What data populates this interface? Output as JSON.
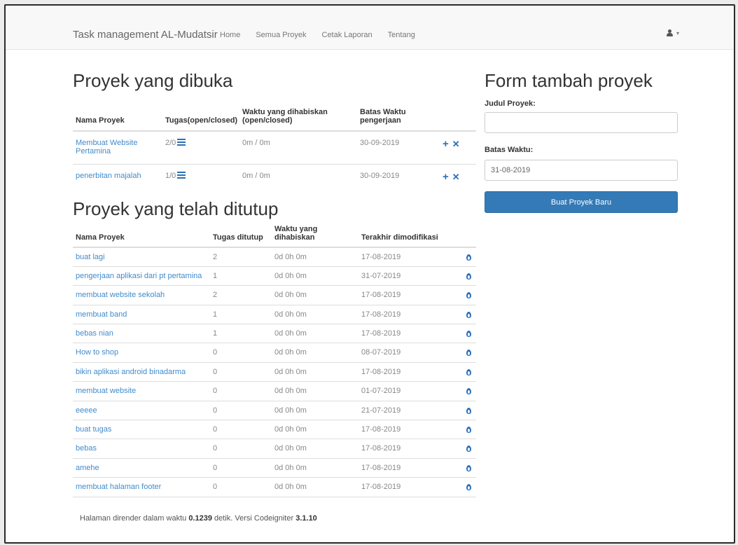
{
  "navbar": {
    "brand": "Task management AL-Mudatsir",
    "links": [
      "Home",
      "Semua Proyek",
      "Cetak Laporan",
      "Tentang"
    ]
  },
  "open_projects": {
    "title": "Proyek yang dibuka",
    "headers": {
      "name": "Nama Proyek",
      "tasks": "Tugas(open/closed)",
      "time_line1": "Waktu yang dihabiskan",
      "time_line2": "(open/closed)",
      "deadline_line1": "Batas Waktu",
      "deadline_line2": "pengerjaan"
    },
    "rows": [
      {
        "name_line1": "Membuat Website",
        "name_line2": "Pertamina",
        "tasks": "2/0",
        "time": "0m / 0m",
        "deadline": "30-09-2019"
      },
      {
        "name_line1": "penerbitan majalah",
        "name_line2": "",
        "tasks": "1/0",
        "time": "0m / 0m",
        "deadline": "30-09-2019"
      }
    ]
  },
  "closed_projects": {
    "title": "Proyek yang telah ditutup",
    "headers": {
      "name": "Nama Proyek",
      "tasks": "Tugas ditutup",
      "time": "Waktu yang dihabiskan",
      "modified": "Terakhir dimodifikasi"
    },
    "rows": [
      {
        "name": "buat lagi",
        "tasks": "2",
        "time": "0d 0h 0m",
        "modified": "17-08-2019"
      },
      {
        "name": "pengerjaan aplikasi dari pt pertamina",
        "tasks": "1",
        "time": "0d 0h 0m",
        "modified": "31-07-2019"
      },
      {
        "name": "membuat website sekolah",
        "tasks": "2",
        "time": "0d 0h 0m",
        "modified": "17-08-2019"
      },
      {
        "name": "membuat band",
        "tasks": "1",
        "time": "0d 0h 0m",
        "modified": "17-08-2019"
      },
      {
        "name": "bebas nian",
        "tasks": "1",
        "time": "0d 0h 0m",
        "modified": "17-08-2019"
      },
      {
        "name": "How to shop",
        "tasks": "0",
        "time": "0d 0h 0m",
        "modified": "08-07-2019"
      },
      {
        "name": "bikin aplikasi android binadarma",
        "tasks": "0",
        "time": "0d 0h 0m",
        "modified": "17-08-2019"
      },
      {
        "name": "membuat website",
        "tasks": "0",
        "time": "0d 0h 0m",
        "modified": "01-07-2019"
      },
      {
        "name": "eeeee",
        "tasks": "0",
        "time": "0d 0h 0m",
        "modified": "21-07-2019"
      },
      {
        "name": "buat tugas",
        "tasks": "0",
        "time": "0d 0h 0m",
        "modified": "17-08-2019"
      },
      {
        "name": "bebas",
        "tasks": "0",
        "time": "0d 0h 0m",
        "modified": "17-08-2019"
      },
      {
        "name": "amehe",
        "tasks": "0",
        "time": "0d 0h 0m",
        "modified": "17-08-2019"
      },
      {
        "name": "membuat halaman footer",
        "tasks": "0",
        "time": "0d 0h 0m",
        "modified": "17-08-2019"
      }
    ]
  },
  "form": {
    "title": "Form tambah proyek",
    "judul_label": "Judul Proyek:",
    "judul_value": "",
    "batas_label": "Batas Waktu:",
    "batas_value": "31-08-2019",
    "submit_label": "Buat Proyek Baru"
  },
  "footer": {
    "prefix": "Halaman dirender dalam waktu",
    "render_time": "0.1239",
    "middle": "detik. Versi Codeigniter",
    "version": "3.1.10"
  },
  "colors": {
    "link": "#428bca",
    "primary": "#337ab7",
    "icon": "#2a70b8"
  }
}
